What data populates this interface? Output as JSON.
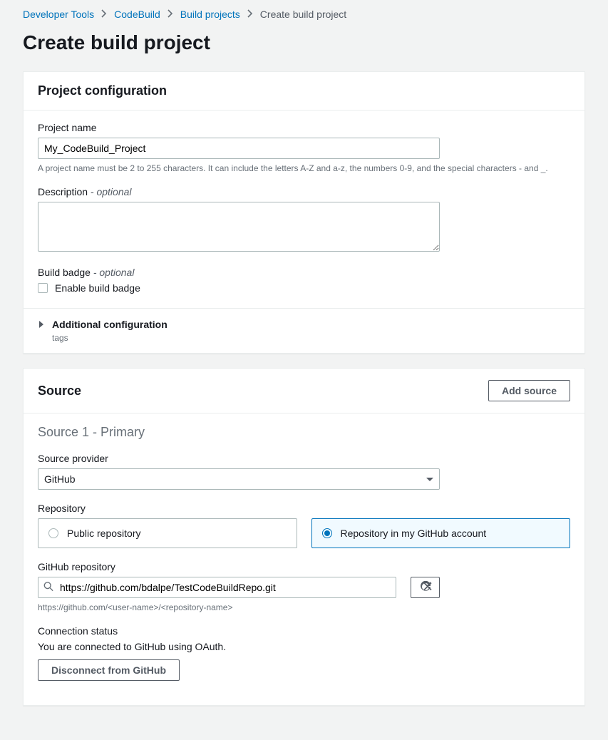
{
  "breadcrumb": {
    "items": [
      "Developer Tools",
      "CodeBuild",
      "Build projects"
    ],
    "current": "Create build project"
  },
  "page_title": "Create build project",
  "project_config": {
    "title": "Project configuration",
    "name_label": "Project name",
    "name_value": "My_CodeBuild_Project",
    "name_hint": "A project name must be 2 to 255 characters. It can include the letters A-Z and a-z, the numbers 0-9, and the special characters - and _.",
    "description_label": "Description",
    "description_optional": " - optional",
    "badge_label": "Build badge",
    "badge_optional": " - optional",
    "badge_checkbox_label": "Enable build badge",
    "additional_title": "Additional configuration",
    "additional_sub": "tags"
  },
  "source": {
    "title": "Source",
    "add_button": "Add source",
    "subtitle": "Source 1 - Primary",
    "provider_label": "Source provider",
    "provider_value": "GitHub",
    "repo_label": "Repository",
    "repo_options": {
      "public": "Public repository",
      "account": "Repository in my GitHub account"
    },
    "gh_repo_label": "GitHub repository",
    "gh_repo_value": "https://github.com/bdalpe/TestCodeBuildRepo.git",
    "gh_repo_hint": "https://github.com/<user-name>/<repository-name>",
    "conn_label": "Connection status",
    "conn_text": "You are connected to GitHub using OAuth.",
    "disconnect_button": "Disconnect from GitHub"
  }
}
